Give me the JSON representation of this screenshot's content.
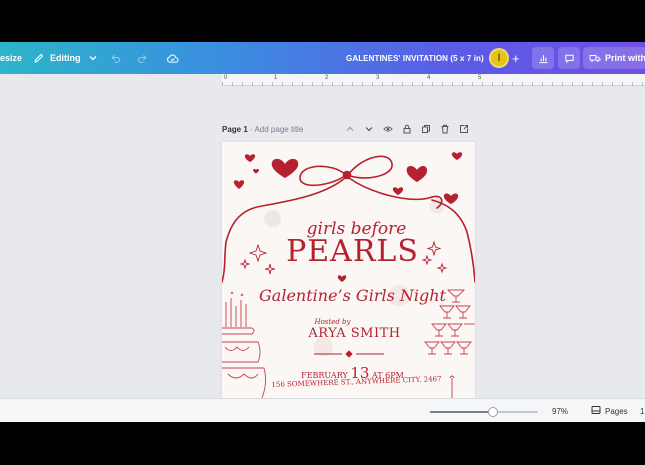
{
  "toolbar": {
    "resize_label": "esize",
    "editing_label": "Editing",
    "doc_title": "GALENTINES' INVITATION (5 x 7 in)",
    "avatar_initial": "l",
    "plus": "+",
    "print_label": "Print with C"
  },
  "ruler": {
    "marks": [
      "0",
      "1",
      "2",
      "3",
      "4",
      "5"
    ]
  },
  "page": {
    "number_label": "Page 1",
    "separator": " - ",
    "title_placeholder": "Add page title"
  },
  "invitation": {
    "script_title": "girls before",
    "main_title": "PEARLS",
    "subtitle": "Galentine’s Girls Night",
    "hosted_by": "Hosted by",
    "host_name": "ARYA SMITH",
    "date_month": "FEBRUARY",
    "date_day": "13",
    "date_time": "AT 6PM",
    "address": "156 SOMEWHERE ST., ANYWHERE CITY, 2467"
  },
  "status": {
    "zoom_value": "97%",
    "zoom_fraction": 0.58,
    "pages_label": "Pages",
    "page_count": "1"
  },
  "colors": {
    "toolbar_gradient_start": "#2cb5c9",
    "toolbar_gradient_end": "#6f4fe3",
    "accent_red": "#b5212f",
    "avatar_yellow": "#e4c416"
  },
  "icons": [
    "pencil-icon",
    "chevron-down-icon",
    "undo-icon",
    "redo-icon",
    "cloud-sync-icon",
    "analytics-icon",
    "comment-icon",
    "truck-icon",
    "lock-icon",
    "duplicate-icon",
    "trash-icon",
    "add-page-icon",
    "eye-icon",
    "pages-icon"
  ]
}
